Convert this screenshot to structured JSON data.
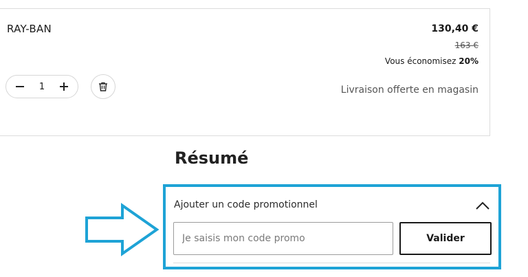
{
  "product": {
    "brand": "RAY-BAN",
    "price": "130,40 €",
    "old_price": "163 €",
    "savings_prefix": "Vous économisez ",
    "savings_value": "20%",
    "quantity": "1",
    "delivery": "Livraison offerte en magasin"
  },
  "summary": {
    "title": "Résumé"
  },
  "promo": {
    "label": "Ajouter un code promotionnel",
    "input_placeholder": "Je saisis mon code promo",
    "input_value": "",
    "validate_label": "Valider"
  },
  "colors": {
    "highlight": "#1ea3d6"
  },
  "icons": {
    "minus": "minus-icon",
    "plus": "plus-icon",
    "trash": "trash-icon",
    "chevron": "chevron-up-icon",
    "arrow": "arrow-right-icon"
  }
}
